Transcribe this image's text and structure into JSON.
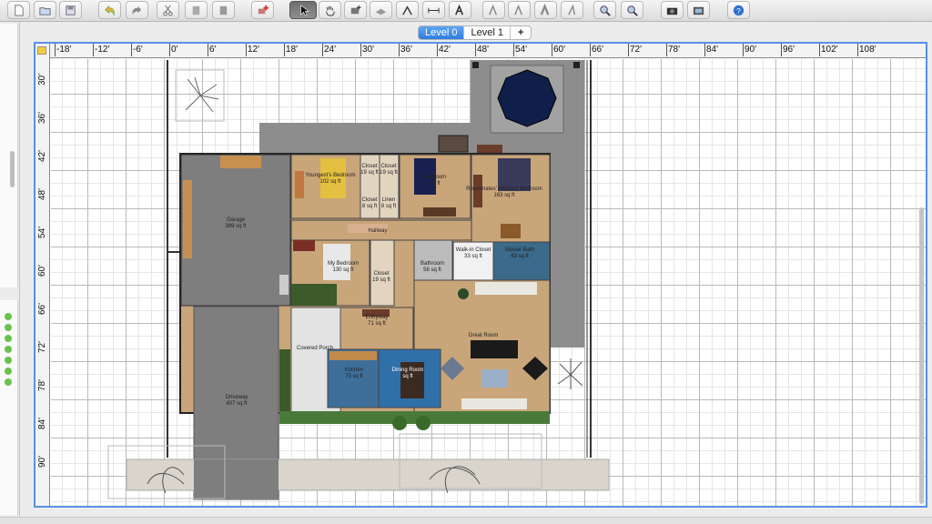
{
  "toolbar": {
    "buttons": [
      {
        "icon": "new-document-icon"
      },
      {
        "icon": "open-folder-icon"
      },
      {
        "icon": "save-icon"
      },
      {
        "icon": "undo-icon"
      },
      {
        "icon": "redo-icon"
      },
      {
        "icon": "cut-icon"
      },
      {
        "icon": "copy-icon"
      },
      {
        "icon": "paste-icon"
      },
      {
        "icon": "add-furniture-icon"
      },
      {
        "icon": "select-arrow-icon"
      },
      {
        "icon": "pan-hand-icon"
      },
      {
        "icon": "create-walls-icon"
      },
      {
        "icon": "create-rooms-icon"
      },
      {
        "icon": "create-polylines-icon"
      },
      {
        "icon": "create-dimensions-icon"
      },
      {
        "icon": "add-text-icon"
      },
      {
        "icon": "text-style-1-icon"
      },
      {
        "icon": "text-style-2-icon"
      },
      {
        "icon": "text-bold-icon"
      },
      {
        "icon": "text-italic-icon"
      },
      {
        "icon": "zoom-in-icon"
      },
      {
        "icon": "zoom-out-icon"
      },
      {
        "icon": "create-photo-icon"
      },
      {
        "icon": "create-video-icon"
      },
      {
        "icon": "help-icon"
      }
    ]
  },
  "tabs": [
    {
      "label": "Level 0",
      "active": true
    },
    {
      "label": "Level 1",
      "active": false
    },
    {
      "label": "+",
      "active": false
    }
  ],
  "ruler": {
    "top": [
      "-18'",
      "-12'",
      "-6'",
      "0'",
      "6'",
      "12'",
      "18'",
      "24'",
      "30'",
      "36'",
      "42'",
      "48'",
      "54'",
      "60'",
      "66'",
      "72'",
      "78'",
      "84'",
      "90'",
      "96'",
      "102'",
      "108'"
    ],
    "left": [
      "30'",
      "36'",
      "42'",
      "48'",
      "54'",
      "60'",
      "66'",
      "72'",
      "78'",
      "84'",
      "90'"
    ]
  },
  "rooms": {
    "youngest": {
      "name": "Youngest's Bedroom",
      "area": "102 sq ft"
    },
    "closet1": {
      "name": "Closet",
      "area": "19 sq ft"
    },
    "closet2": {
      "name": "Closet",
      "area": "19 sq ft"
    },
    "closet_small1": {
      "name": "Closet",
      "area": "8 sq ft"
    },
    "linen": {
      "name": "Linen",
      "area": "8 sq ft"
    },
    "bedroom": {
      "name": "Bedroom",
      "area": "sq ft"
    },
    "master": {
      "name": "Roommates' (Master) Bedroom",
      "area": "163 sq ft"
    },
    "garage": {
      "name": "Garage",
      "area": "389 sq ft"
    },
    "hallway": {
      "name": "Hallway",
      "area": ""
    },
    "my_bedroom": {
      "name": "My Bedroom",
      "area": "130 sq ft"
    },
    "closet3": {
      "name": "Closet",
      "area": "19 sq ft"
    },
    "bathroom": {
      "name": "Bathroom",
      "area": "56 sq ft"
    },
    "walkin": {
      "name": "Walk-in Closet",
      "area": "33 sq ft"
    },
    "master_bath": {
      "name": "Master Bath",
      "area": "43 sq ft"
    },
    "entryway": {
      "name": "Entryway",
      "area": "71 sq ft"
    },
    "great_room": {
      "name": "Great Room",
      "area": ""
    },
    "covered_porch": {
      "name": "Covered Porch",
      "area": ""
    },
    "kitchen": {
      "name": "Kitchen",
      "area": "70 sq ft"
    },
    "dining": {
      "name": "Dining Room",
      "area": "sq ft"
    },
    "driveway": {
      "name": "Driveway",
      "area": "407 sq ft"
    }
  }
}
